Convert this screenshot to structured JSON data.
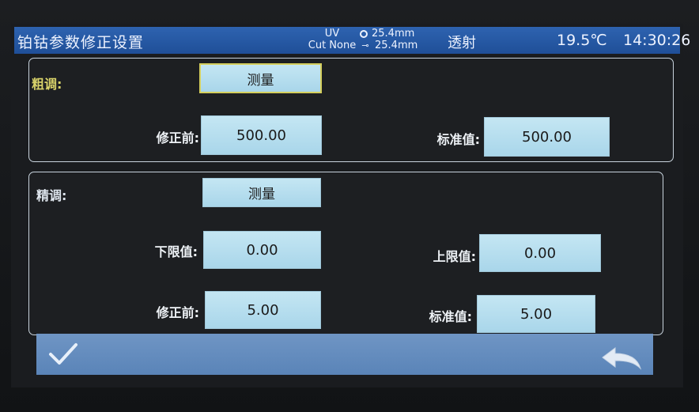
{
  "header": {
    "title": "铂钴参数修正设置",
    "mode_line1": "UV",
    "mode_line2": "Cut None",
    "dim1": "25.4mm",
    "dim2": "25.4mm",
    "measure_mode": "透射",
    "temperature": "19.5℃",
    "time": "14:30:26"
  },
  "coarse": {
    "title": "粗调:",
    "measure_button": "测量",
    "before_label": "修正前:",
    "before_value": "500.00",
    "standard_label": "标准值:",
    "standard_value": "500.00"
  },
  "fine": {
    "title": "精调:",
    "measure_button": "测量",
    "lower_label": "下限值:",
    "lower_value": "0.00",
    "upper_label": "上限值:",
    "upper_value": "0.00",
    "before_label": "修正前:",
    "before_value": "5.00",
    "standard_label": "标准值:",
    "standard_value": "5.00"
  },
  "footer": {
    "confirm_icon": "checkmark-icon",
    "back_icon": "return-arrow-icon"
  },
  "colors": {
    "title_bar": "#2559a4",
    "field": "#b7def0",
    "footer_bar": "#6389bc",
    "coarse_title": "#d9d36a"
  }
}
